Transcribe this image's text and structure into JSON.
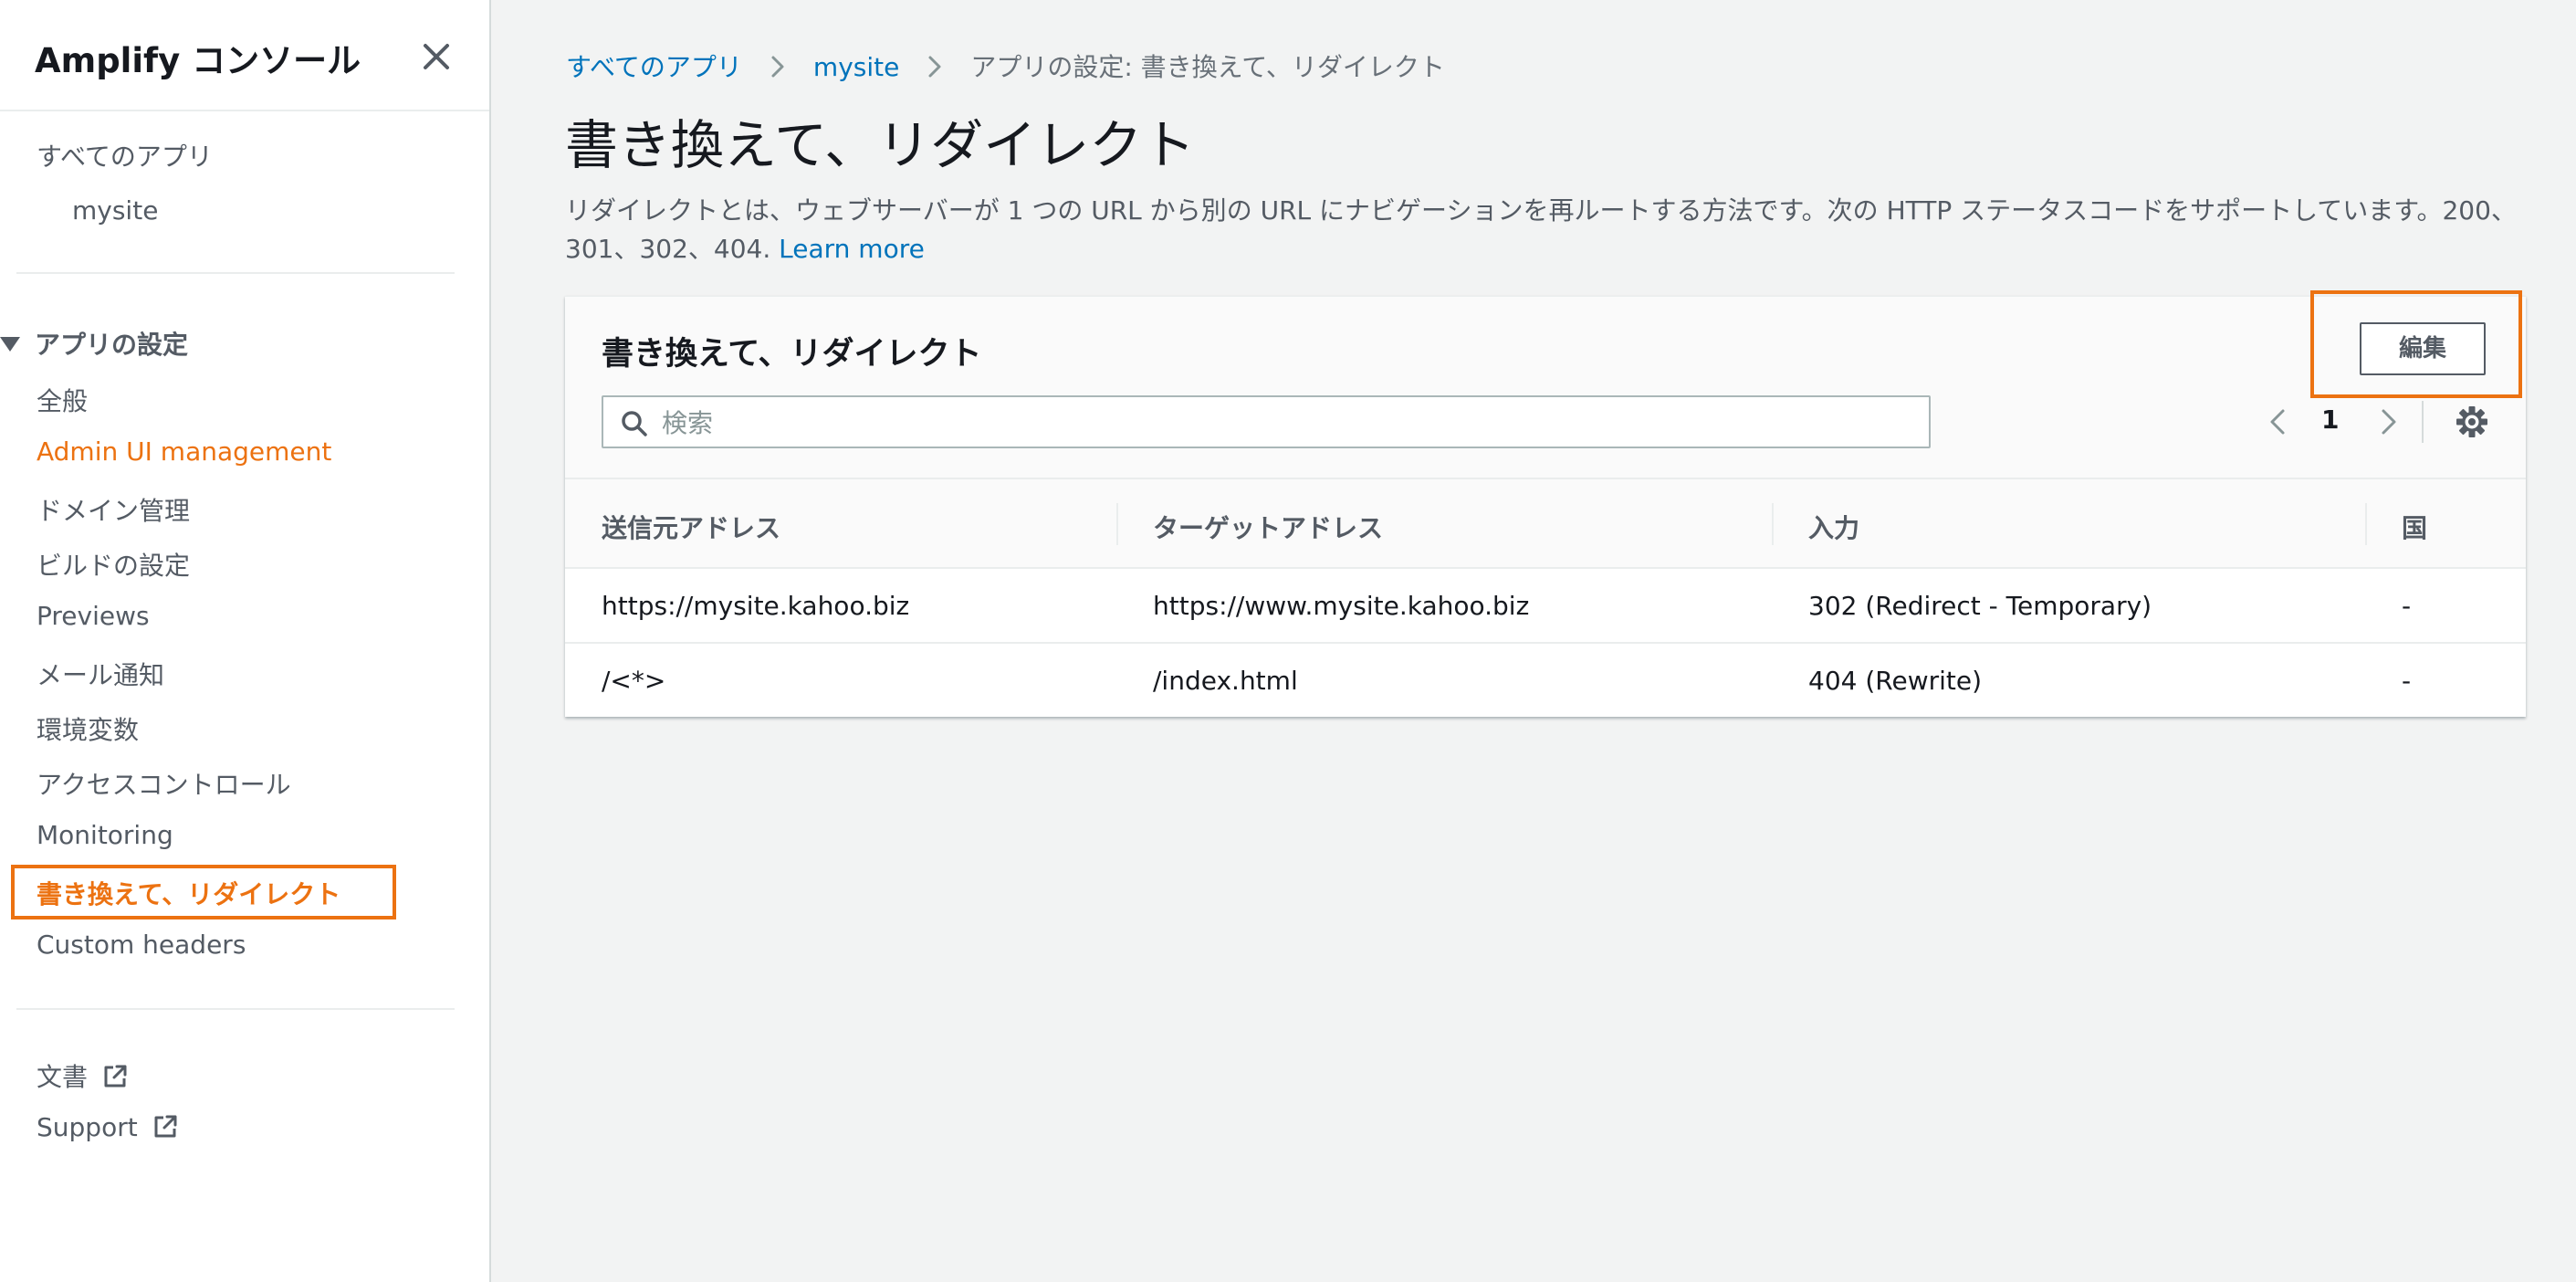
{
  "sidebar": {
    "title": "Amplify コンソール",
    "all_apps": "すべてのアプリ",
    "app_name": "mysite",
    "section_label": "アプリの設定",
    "items": [
      {
        "label": "全般"
      },
      {
        "label": "Admin UI management"
      },
      {
        "label": "ドメイン管理"
      },
      {
        "label": "ビルドの設定"
      },
      {
        "label": "Previews"
      },
      {
        "label": "メール通知"
      },
      {
        "label": "環境変数"
      },
      {
        "label": "アクセスコントロール"
      },
      {
        "label": "Monitoring"
      },
      {
        "label": "書き換えて、リダイレクト"
      },
      {
        "label": "Custom headers"
      }
    ],
    "footer_links": [
      {
        "label": "文書"
      },
      {
        "label": "Support"
      }
    ]
  },
  "breadcrumb": {
    "items": [
      {
        "label": "すべてのアプリ"
      },
      {
        "label": "mysite"
      },
      {
        "label": "アプリの設定: 書き換えて、リダイレクト"
      }
    ]
  },
  "page": {
    "title": "書き換えて、リダイレクト",
    "description": "リダイレクトとは、ウェブサーバーが 1 つの URL から別の URL にナビゲーションを再ルートする方法です。次の HTTP ステータスコードをサポートしています。200、301、302、404.",
    "learn_more": "Learn more"
  },
  "card": {
    "title": "書き換えて、リダイレクト",
    "edit_label": "編集",
    "search_placeholder": "検索",
    "page_number": "1",
    "columns": [
      "送信元アドレス",
      "ターゲットアドレス",
      "入力",
      "国"
    ],
    "rows": [
      [
        "https://mysite.kahoo.biz",
        "https://www.mysite.kahoo.biz",
        "302 (Redirect - Temporary)",
        "-"
      ],
      [
        "/<*>",
        "/index.html",
        "404 (Rewrite)",
        "-"
      ]
    ]
  },
  "colors": {
    "accent": "#ec7211",
    "link": "#0073bb",
    "background": "#f2f3f3"
  },
  "icons": {
    "close": "close-icon",
    "external": "external-link-icon",
    "search": "search-icon",
    "settings": "gear-icon",
    "prev": "chevron-left-icon",
    "next": "chevron-right-icon",
    "section": "caret-down-icon",
    "separator": "chevron-right-icon"
  }
}
